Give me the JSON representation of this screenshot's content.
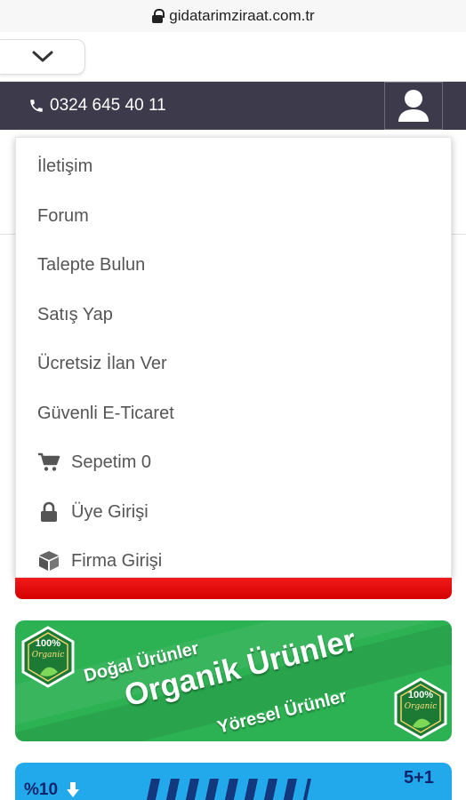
{
  "browser": {
    "url": "gidatarimziraat.com.tr"
  },
  "topbar": {
    "phone": "0324 645 40 11"
  },
  "menu": {
    "items": [
      {
        "label": "İletişim"
      },
      {
        "label": "Forum"
      },
      {
        "label": "Talepte Bulun"
      },
      {
        "label": "Satış Yap"
      },
      {
        "label": "Ücretsiz İlan Ver"
      },
      {
        "label": "Güvenli E-Ticaret"
      },
      {
        "label": "Sepetim 0",
        "icon": "cart-icon"
      },
      {
        "label": "Üye Girişi",
        "icon": "lock-icon"
      },
      {
        "label": "Firma Girişi",
        "icon": "box-icon"
      }
    ]
  },
  "banner": {
    "line1": "Doğal Ürünler",
    "line2": "Organik Ürünler",
    "line3": "Yöresel Ürünler",
    "badge_percent": "100%",
    "badge_label": "Organic"
  },
  "banner2": {
    "left_text": "%10",
    "right_text": "5+1"
  },
  "colors": {
    "header": "#3d3a4b",
    "accent_red": "#e60000",
    "banner_green": "#2db253",
    "banner_blue": "#21a9ec"
  }
}
